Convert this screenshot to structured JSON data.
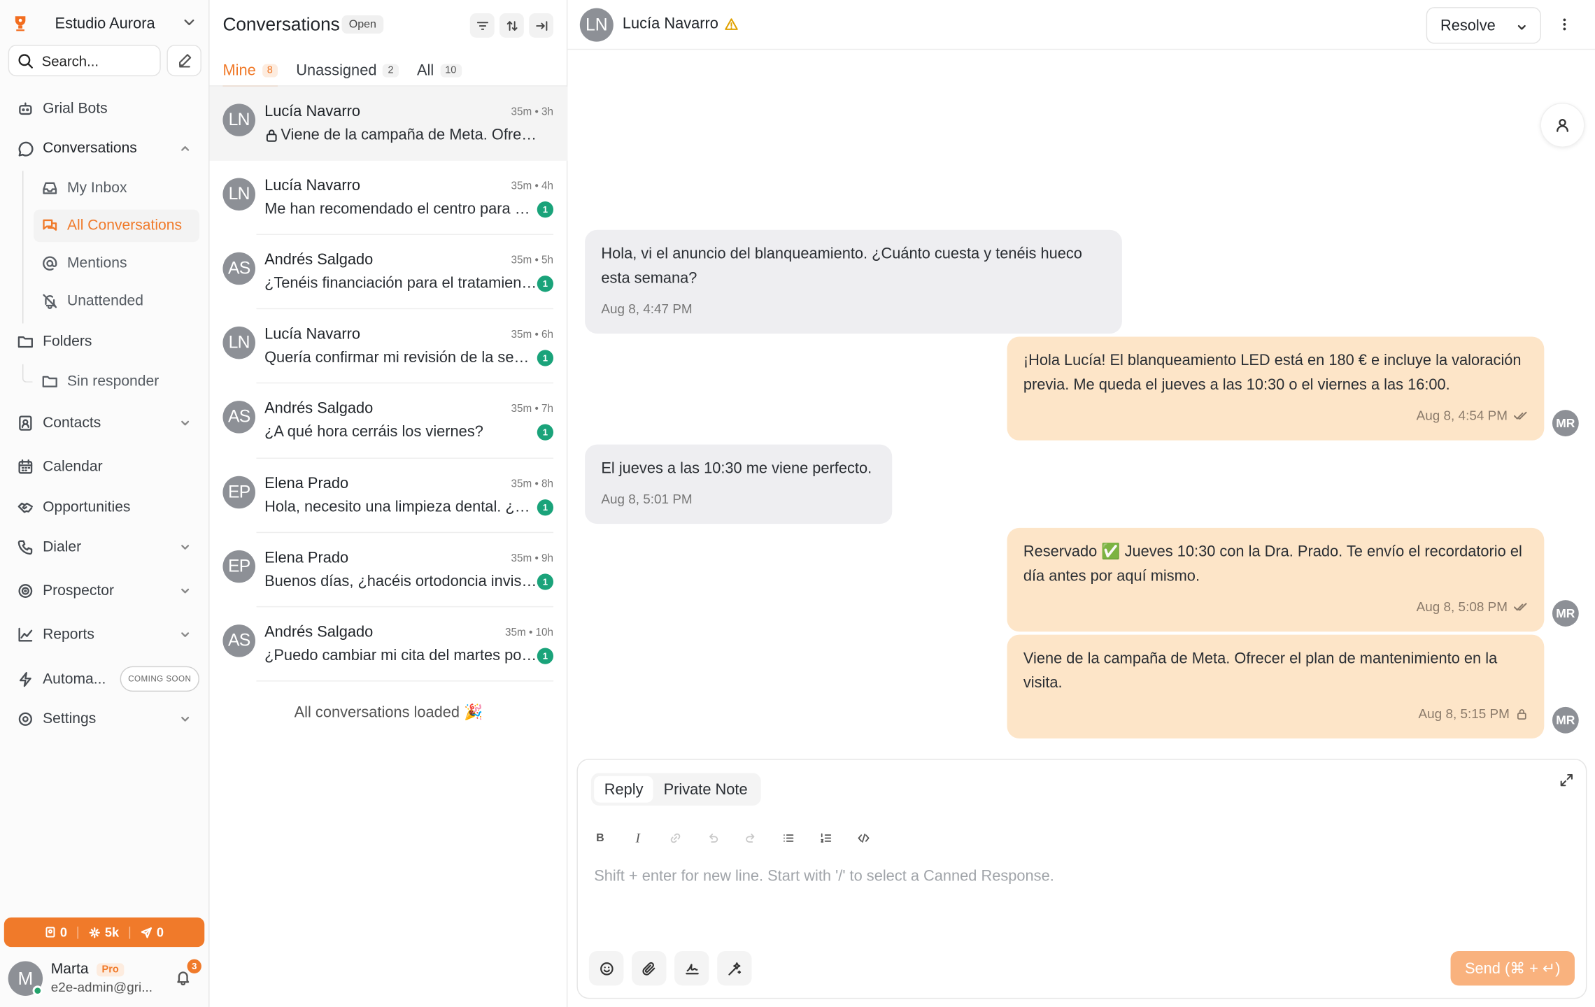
{
  "workspace": {
    "name": "Estudio Aurora"
  },
  "search": {
    "placeholder": "Search..."
  },
  "sidebar": {
    "items": [
      {
        "label": "Grial Bots"
      },
      {
        "label": "Conversations"
      },
      {
        "label": "My Inbox"
      },
      {
        "label": "All Conversations"
      },
      {
        "label": "Mentions"
      },
      {
        "label": "Unattended"
      },
      {
        "label": "Folders"
      },
      {
        "label": "Sin responder"
      },
      {
        "label": "Contacts"
      },
      {
        "label": "Calendar"
      },
      {
        "label": "Opportunities"
      },
      {
        "label": "Dialer"
      },
      {
        "label": "Prospector"
      },
      {
        "label": "Reports"
      },
      {
        "label": "Automa..."
      },
      {
        "label": "Settings"
      }
    ],
    "coming_soon": "COMING SOON",
    "credits": {
      "contacts": "0",
      "ai": "5k",
      "sent": "0"
    },
    "user": {
      "initial": "M",
      "name": "Marta",
      "plan": "Pro",
      "email": "e2e-admin@gri...",
      "notifications": "3"
    }
  },
  "list": {
    "title": "Conversations",
    "status": "Open",
    "tabs": [
      {
        "label": "Mine",
        "count": "8"
      },
      {
        "label": "Unassigned",
        "count": "2"
      },
      {
        "label": "All",
        "count": "10"
      }
    ],
    "conversations": [
      {
        "initials": "LN",
        "name": "Lucía Navarro",
        "time": "35m • 3h",
        "preview": "Viene de la campaña de Meta. Ofrecer el plan de mantenimiento en la visita.",
        "unread": "",
        "private": true
      },
      {
        "initials": "LN",
        "name": "Lucía Navarro",
        "time": "35m • 4h",
        "preview": "Me han recomendado el centro para una revisión",
        "unread": "1"
      },
      {
        "initials": "AS",
        "name": "Andrés Salgado",
        "time": "35m • 5h",
        "preview": "¿Tenéis financiación para el tratamiento?",
        "unread": "1"
      },
      {
        "initials": "LN",
        "name": "Lucía Navarro",
        "time": "35m • 6h",
        "preview": "Quería confirmar mi revisión de la semana",
        "unread": "1"
      },
      {
        "initials": "AS",
        "name": "Andrés Salgado",
        "time": "35m • 7h",
        "preview": "¿A qué hora cerráis los viernes?",
        "unread": "1"
      },
      {
        "initials": "EP",
        "name": "Elena Prado",
        "time": "35m • 8h",
        "preview": "Hola, necesito una limpieza dental. ¿Tenéis hueco?",
        "unread": "1"
      },
      {
        "initials": "EP",
        "name": "Elena Prado",
        "time": "35m • 9h",
        "preview": "Buenos días, ¿hacéis ortodoncia invisible?",
        "unread": "1"
      },
      {
        "initials": "AS",
        "name": "Andrés Salgado",
        "time": "35m • 10h",
        "preview": "¿Puedo cambiar mi cita del martes por otro día?",
        "unread": "1"
      }
    ],
    "footer": "All conversations loaded 🎉"
  },
  "chat": {
    "contact": {
      "initials": "LN",
      "name": "Lucía Navarro"
    },
    "resolve_label": "Resolve",
    "agent_initials": "MR",
    "messages": [
      {
        "dir": "in",
        "text": "Hola, vi el anuncio del blanqueamiento. ¿Cuánto cuesta y tenéis hueco esta semana?",
        "time": "Aug 8, 4:47 PM"
      },
      {
        "dir": "out",
        "text": "¡Hola Lucía! El blanqueamiento LED está en 180 € e incluye la valoración previa. Me queda el jueves a las 10:30 o el viernes a las 16:00.",
        "time": "Aug 8, 4:54 PM"
      },
      {
        "dir": "in",
        "text": "El jueves a las 10:30 me viene perfecto.",
        "time": "Aug 8, 5:01 PM"
      },
      {
        "dir": "out",
        "text": "Reservado ✅ Jueves 10:30 con la Dra. Prado. Te envío el recordatorio el día antes por aquí mismo.",
        "time": "Aug 8, 5:08 PM"
      },
      {
        "dir": "out",
        "text": "Viene de la campaña de Meta. Ofrecer el plan de mantenimiento en la visita.",
        "time": "Aug 8, 5:15 PM",
        "private": true
      }
    ]
  },
  "composer": {
    "tabs": [
      {
        "label": "Reply"
      },
      {
        "label": "Private Note"
      }
    ],
    "placeholder": "Shift + enter for new line. Start with '/' to select a Canned Response.",
    "send_label": "Send (⌘ + ↵)"
  },
  "colors": {
    "accent": "#f07a2a",
    "outgoing": "#fde5c8",
    "incoming": "#eeeef1",
    "unread": "#1aa37a"
  }
}
